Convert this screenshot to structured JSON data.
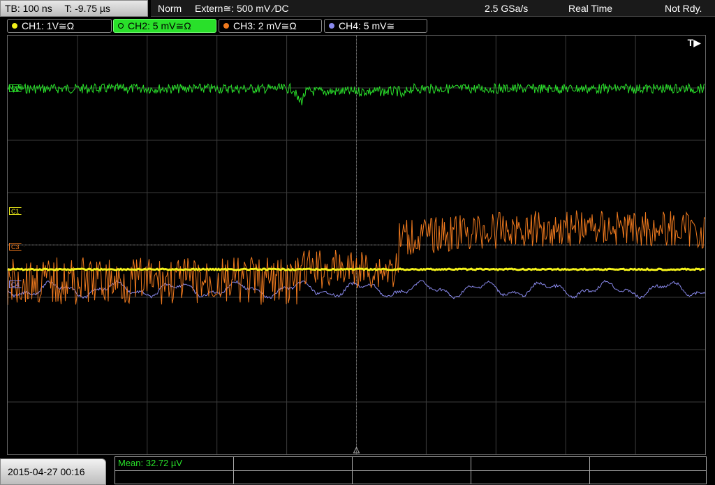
{
  "timebase": {
    "tb": "TB: 100 ns",
    "trigger_time": "T: -9.75 µs"
  },
  "acquisition": {
    "mode": "Norm",
    "trigger_source": "Extern≅: 500 mV ⁄DC",
    "sample_rate": "2.5 GSa/s",
    "realtime": "Real Time",
    "status": "Not Rdy."
  },
  "channels": [
    {
      "id": "ch1",
      "label": "CH1: 1V≅Ω",
      "color": "#f2f01a",
      "marker": "C1"
    },
    {
      "id": "ch2",
      "label": "CH2: 5 mV≅Ω",
      "color": "#29e02a",
      "marker": "C2"
    },
    {
      "id": "ch3",
      "label": "CH3: 2 mV≅Ω",
      "color": "#f07a1e",
      "marker": "C3"
    },
    {
      "id": "ch4",
      "label": "CH4: 5 mV≅",
      "color": "#8a8aee",
      "marker": "C4"
    }
  ],
  "trigger_marker": "T▶",
  "bottom": {
    "datetime": "2015-04-27 00:16",
    "measurement": "Mean: 32.72 µV"
  },
  "colors": {
    "grid": "#3c3c3c",
    "grid_center": "#6a6a6a",
    "accent": "#29e02a"
  }
}
